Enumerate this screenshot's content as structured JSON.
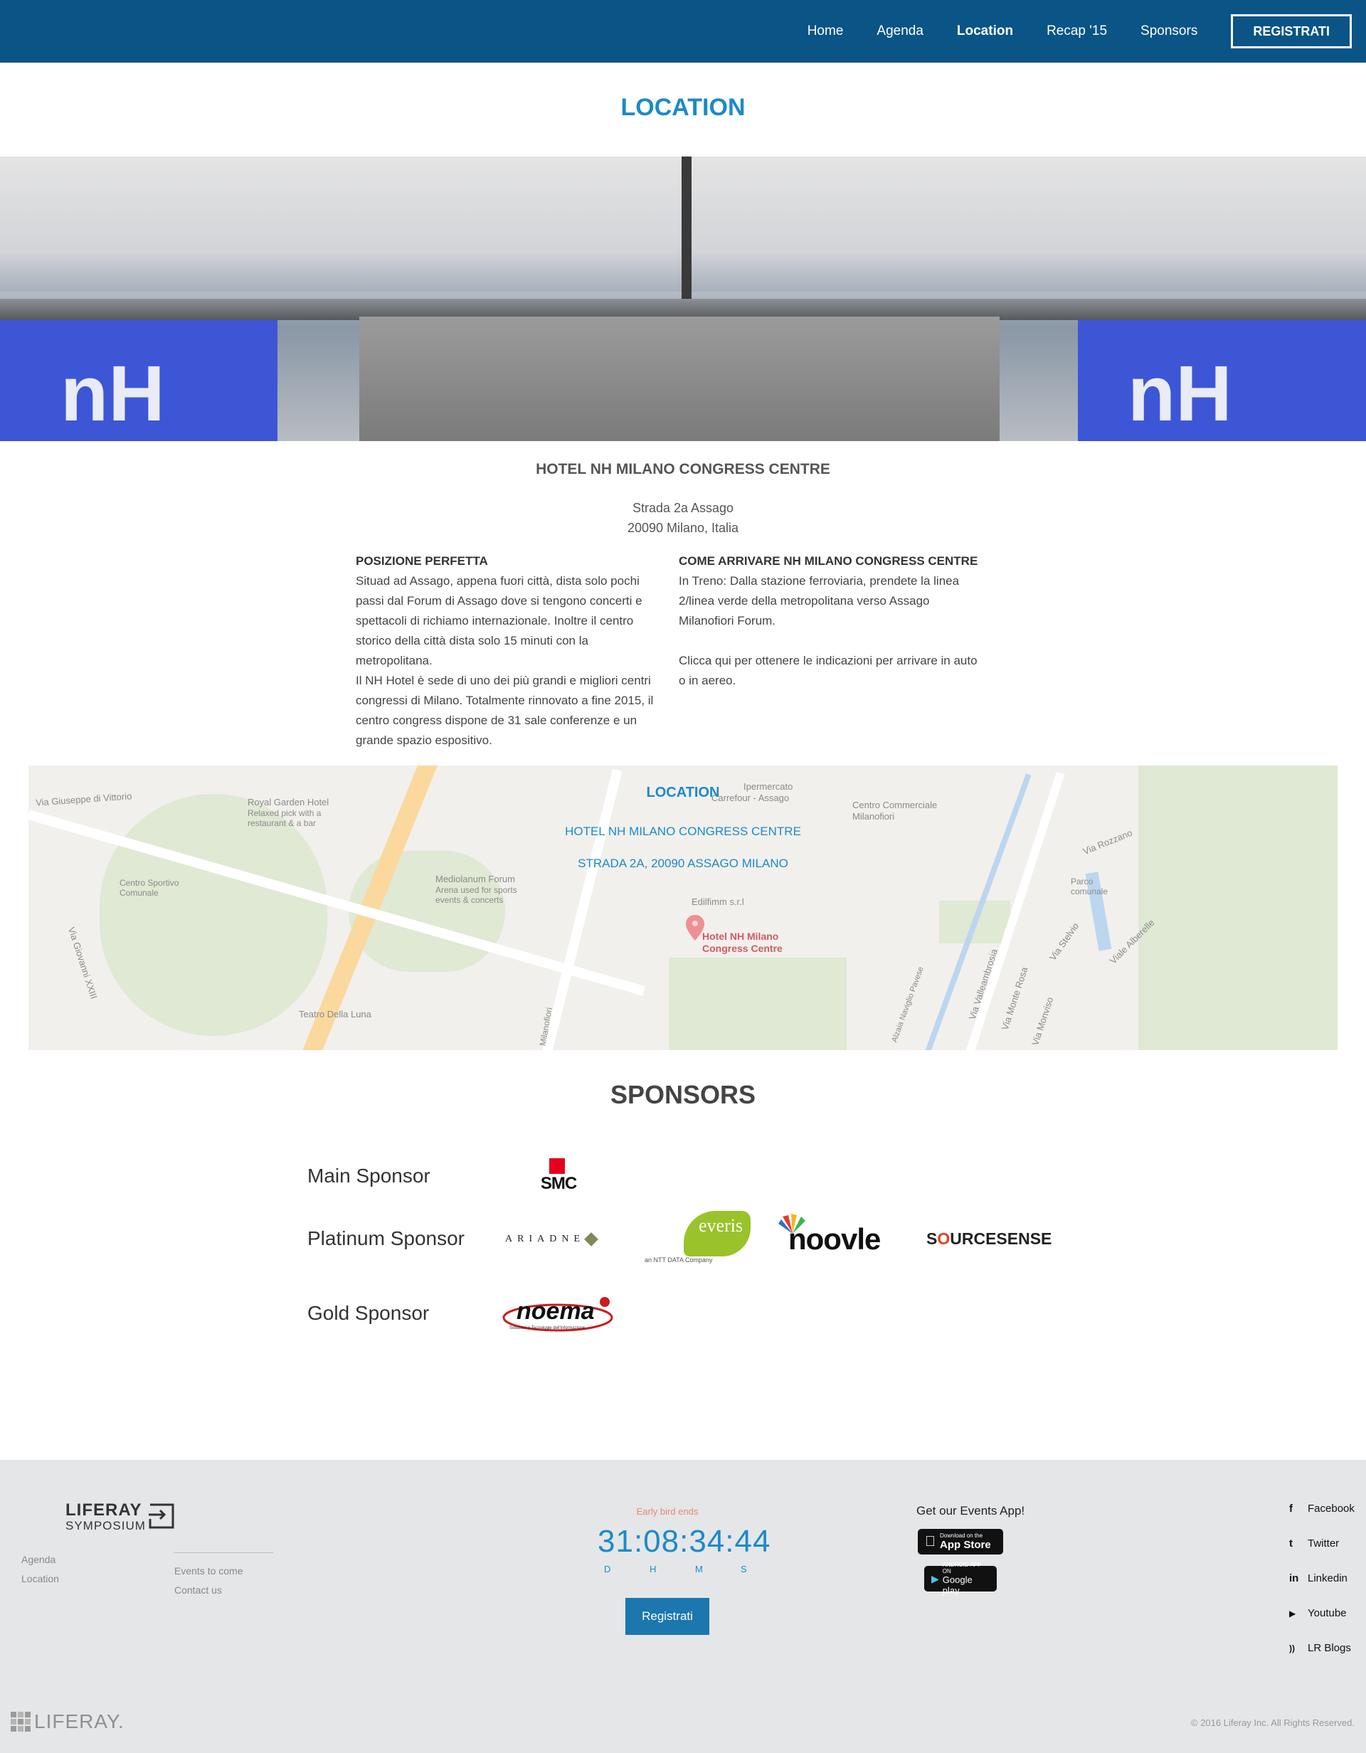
{
  "nav": {
    "links": [
      {
        "label": "Home"
      },
      {
        "label": "Agenda"
      },
      {
        "label": "Location"
      },
      {
        "label": "Recap '15"
      },
      {
        "label": "Sponsors"
      }
    ],
    "register_label": "REGISTRATI"
  },
  "location_title": "LOCATION",
  "hero": {
    "sign_text": "nH"
  },
  "hotel": {
    "name": "HOTEL NH MILANO CONGRESS CENTRE",
    "address_line1": "Strada 2a Assago",
    "address_line2": "20090 Milano, Italia"
  },
  "position": {
    "heading": "POSIZIONE PERFETTA",
    "para1": "Situad ad Assago, appena fuori città, dista solo pochi passi dal Forum di Assago dove si tengono concerti e spettacoli di richiamo internazionale. Inoltre il centro storico della città dista solo 15 minuti con la metropolitana.",
    "para2": "Il NH Hotel è sede di uno dei più grandi e migliori centri congressi di Milano. Totalmente rinnovato a fine 2015, il centro congress dispone de 31 sale conferenze e un grande spazio espositivo."
  },
  "arrive": {
    "heading": "COME ARRIVARE NH MILANO CONGRESS CENTRE",
    "para1": "In Treno: Dalla stazione ferroviaria, prendete la linea 2/linea verde della metropolitana verso Assago Milanofiori Forum.",
    "para2": "Clicca qui per ottenere le indicazioni per arrivare in auto o in aereo."
  },
  "map": {
    "overlay_title": "LOCATION",
    "overlay_line1": "HOTEL NH MILANO CONGRESS CENTRE",
    "overlay_line2": "STRADA 2A, 20090 ASSAGO MILANO",
    "pin_label_line1": "Hotel NH Milano",
    "pin_label_line2": "Congress Centre",
    "labels": {
      "via_vittorio": "Via Giuseppe di Vittorio",
      "royal": "Royal Garden Hotel",
      "royal_sub": "Relaxed pick with a restaurant & a bar",
      "centro_sportivo": "Centro Sportivo Comunale",
      "mediolanum": "Mediolanum Forum",
      "mediolanum_sub": "Arena used for sports events & concerts",
      "via_giovanni": "Via Giovanni XXIII",
      "teatro": "Teatro Della Luna",
      "ipermercato": "Ipermercato",
      "carrefour": "Carrefour - Assago",
      "centro_comm": "Centro Commerciale",
      "milanofiori": "Milanofiori",
      "edilfimm": "Edilfimm s.r.l",
      "via_rozzano": "Via Rozzano",
      "parco": "Parco comunale",
      "via_stelvio": "Via Stelvio",
      "viale_alberelle": "Viale Alberelle",
      "via_monte_rosa": "Via Monte Rosa",
      "via_monviso": "Via Monviso",
      "via_vallea": "Via Valleambrosia",
      "alzaia": "Alzaia Naviglio Pavese",
      "milanofiori_road": "Milanofiori"
    }
  },
  "sponsors": {
    "title": "SPONSORS",
    "main_label": "Main Sponsor",
    "platinum_label": "Platinum Sponsor",
    "gold_label": "Gold Sponsor",
    "logos": {
      "smc": "SMC",
      "ariadne": "ARIADNE",
      "everis": "everis",
      "everis_sub": "an NTT DATA Company",
      "noovle": "noovle",
      "sourcesense_a": "S",
      "sourcesense_o": "O",
      "sourcesense_b": "URCESENSE",
      "noema": "noema",
      "noema_sub": "Soluzioni e Tecnologie dell'informazione"
    }
  },
  "footer": {
    "brand_line1": "LIFERAY",
    "brand_line2": "SYMPOSIUM",
    "links_col1": [
      "Agenda",
      "Location"
    ],
    "links_col2": [
      "Events to come",
      "Contact us"
    ],
    "early_bird": "Early bird ends",
    "countdown": "31:08:34:44",
    "units": [
      "D",
      "H",
      "M",
      "S"
    ],
    "register_label": "Registrati",
    "app_title": "Get our Events App!",
    "appstore_small": "Download on the",
    "appstore_large": "App Store",
    "googleplay_small": "ANDROID APP ON",
    "googleplay_large": "Google play",
    "social": [
      {
        "icon": "facebook-icon",
        "glyph": "f",
        "label": "Facebook"
      },
      {
        "icon": "twitter-icon",
        "glyph": "t",
        "label": "Twitter"
      },
      {
        "icon": "linkedin-icon",
        "glyph": "in",
        "label": "Linkedin"
      },
      {
        "icon": "youtube-icon",
        "glyph": "▶",
        "label": "Youtube"
      },
      {
        "icon": "rss-icon",
        "glyph": "))",
        "label": "LR Blogs"
      }
    ],
    "liferay_wordmark": "LIFERAY.",
    "copyright": "© 2016 Liferay Inc. All Rights Reserved."
  }
}
